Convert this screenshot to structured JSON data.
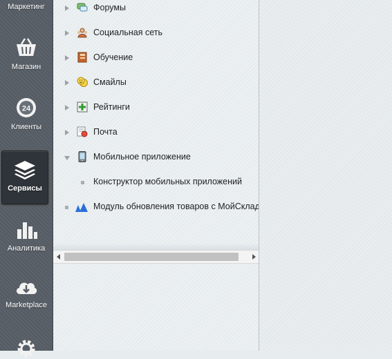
{
  "sidebar": {
    "items": [
      {
        "label": "Маркетинг",
        "icon": "marketing-icon"
      },
      {
        "label": "Магазин",
        "icon": "basket-icon"
      },
      {
        "label": "Клиенты",
        "icon": "clients-24-icon",
        "badge": "24"
      },
      {
        "label": "Сервисы",
        "icon": "layers-icon",
        "active": true
      },
      {
        "label": "Аналитика",
        "icon": "bar-chart-icon"
      },
      {
        "label": "Marketplace",
        "icon": "cloud-download-icon"
      },
      {
        "label": "",
        "icon": "gear-icon"
      }
    ]
  },
  "tree": {
    "items": [
      {
        "label": "Форумы",
        "icon": "forum-icon",
        "state": "collapsed"
      },
      {
        "label": "Социальная сеть",
        "icon": "social-network-icon",
        "state": "collapsed"
      },
      {
        "label": "Обучение",
        "icon": "learning-icon",
        "state": "collapsed"
      },
      {
        "label": "Смайлы",
        "icon": "smiley-icon",
        "state": "collapsed"
      },
      {
        "label": "Рейтинги",
        "icon": "ratings-icon",
        "state": "collapsed"
      },
      {
        "label": "Почта",
        "icon": "mail-icon",
        "state": "collapsed"
      },
      {
        "label": "Мобильное приложение",
        "icon": "mobile-app-icon",
        "state": "expanded"
      },
      {
        "label": "Конструктор мобильных приложений",
        "state": "leaf-child"
      },
      {
        "label": "Модуль обновления товаров с МойСклад",
        "icon": "moysklad-icon",
        "state": "leaf"
      }
    ]
  },
  "colors": {
    "sidebar_bg": "#585e66",
    "active_bg": "#2f343a",
    "panel_bg": "#e9eef0"
  }
}
